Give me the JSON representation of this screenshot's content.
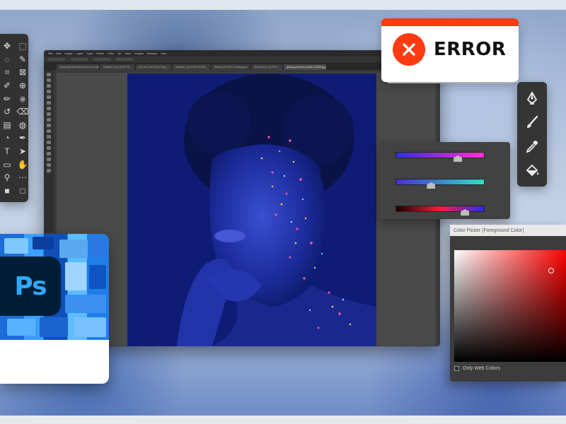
{
  "error": {
    "label": "ERROR",
    "accent": "#ff3b12"
  },
  "ps_logo": {
    "text": "Ps",
    "bg": "#001e36",
    "fg": "#31a8ff"
  },
  "menubar": {
    "items": [
      "File",
      "Edit",
      "Image",
      "Layer",
      "Type",
      "Select",
      "Filter",
      "3D",
      "View",
      "Plugins",
      "Window",
      "Help"
    ]
  },
  "tabs": [
    {
      "label": "bioquantik-lifestyles-colours-of-colour..."
    },
    {
      "label": "Untitled Card @ 66.7%..."
    },
    {
      "label": "Vel. Ant. Ins-Fields Copy..."
    },
    {
      "label": "Untitled-1 @ 33.3% (RGB)..."
    },
    {
      "label": "Shanno-Fs-0012 nothing.psd"
    },
    {
      "label": "Document-1 @ 50%..."
    },
    {
      "label": "glowing-freckles-studio-123456.jpg @..."
    }
  ],
  "left_tools": [
    "move-icon",
    "marquee-icon",
    "lasso-icon",
    "quick-select-icon",
    "crop-icon",
    "frame-icon",
    "eyedropper-icon",
    "healing-icon",
    "brush-icon",
    "stamp-icon",
    "history-brush-icon",
    "eraser-icon",
    "gradient-icon",
    "blur-icon",
    "dodge-icon",
    "pen-icon",
    "type-icon",
    "path-select-icon",
    "shape-icon",
    "hand-icon",
    "zoom-icon",
    "edit-toolbar-icon",
    "foreground-color-icon",
    "background-color-icon"
  ],
  "right_tools": [
    "pen-tool-icon",
    "brush-tool-icon",
    "eyedropper-tool-icon",
    "paint-bucket-icon"
  ],
  "sliders": [
    {
      "gradient": "linear-gradient(90deg,#2f2fd8,#ff2fd0)",
      "value": 0.7
    },
    {
      "gradient": "linear-gradient(90deg,#4a2fd8,#2fe0c0)",
      "value": 0.4
    },
    {
      "gradient": "linear-gradient(90deg,#1a0000,#ff1a3a,#2a2aff)",
      "value": 0.78
    }
  ],
  "color_picker": {
    "title": "Color Picker (Foreground Color)",
    "only_web_colors": "Only Web Colors"
  }
}
